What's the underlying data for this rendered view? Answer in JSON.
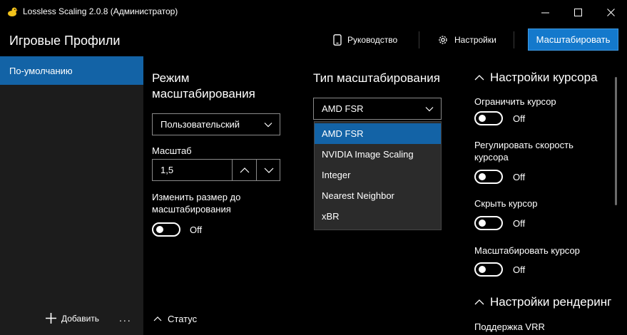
{
  "window": {
    "title": "Lossless Scaling 2.0.8 (Администратор)"
  },
  "header": {
    "title": "Игровые Профили",
    "guide_label": "Руководство",
    "settings_label": "Настройки",
    "scale_button_label": "Масштабировать"
  },
  "sidebar": {
    "items": [
      {
        "label": "По-умолчанию",
        "selected": true
      }
    ],
    "add_label": "Добавить",
    "more_label": "..."
  },
  "scaling_mode": {
    "heading": "Режим масштабирования",
    "selected": "Пользовательский",
    "scale_label": "Масштаб",
    "scale_value": "1,5",
    "resize_label": "Изменить размер до масштабирования",
    "resize_toggle": "Off"
  },
  "scaling_type": {
    "heading": "Тип масштабирования",
    "selected": "AMD FSR",
    "options": [
      "AMD FSR",
      "NVIDIA Image Scaling",
      "Integer",
      "Nearest Neighbor",
      "xBR"
    ]
  },
  "cursor_settings": {
    "heading": "Настройки курсора",
    "items": [
      {
        "label": "Ограничить курсор",
        "state": "Off"
      },
      {
        "label": "Регулировать скорость курсора",
        "state": "Off"
      },
      {
        "label": "Скрыть курсор",
        "state": "Off"
      },
      {
        "label": "Масштабировать курсор",
        "state": "Off"
      }
    ]
  },
  "render_settings": {
    "heading": "Настройки рендеринг",
    "first_item": "Поддержка VRR"
  },
  "status": {
    "label": "Статус"
  },
  "colors": {
    "accent": "#1479cc",
    "selection": "#1363a6",
    "sidebar_bg": "#1c1c1c",
    "dropdown_bg": "#2b2b2b"
  }
}
